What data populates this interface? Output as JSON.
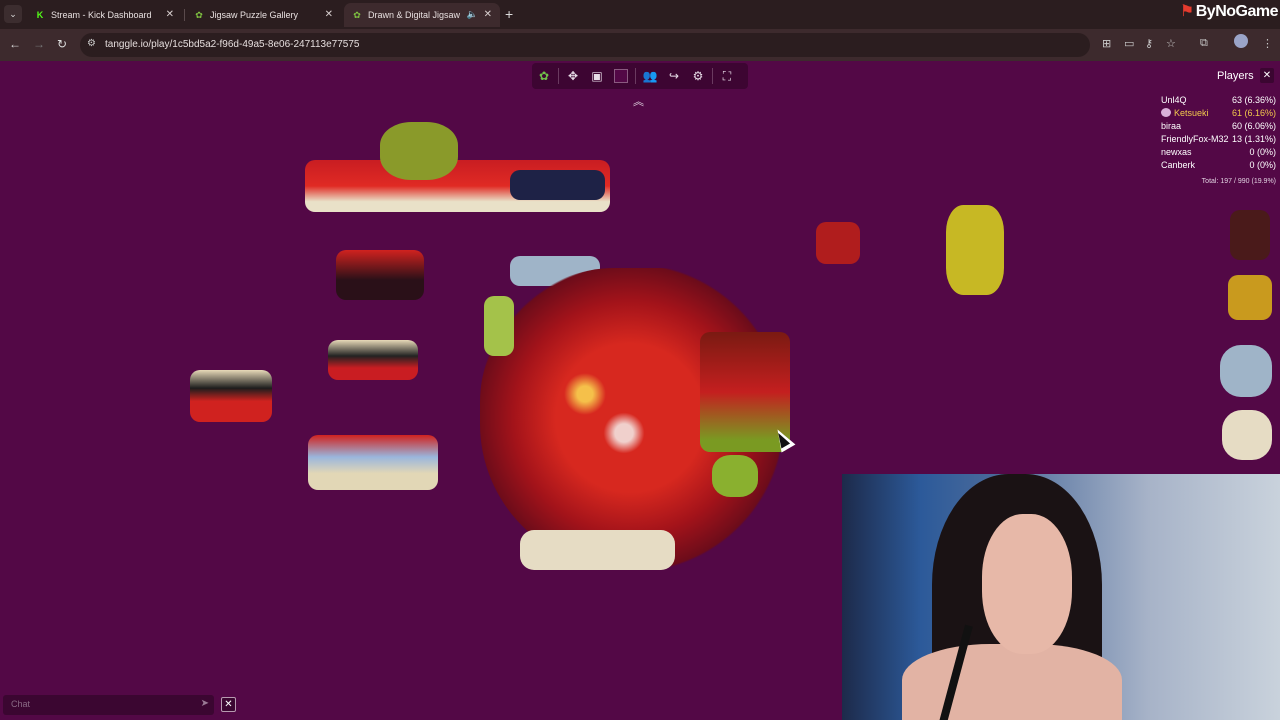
{
  "browser": {
    "tabs": [
      {
        "label": "Stream - Kick Dashboard",
        "icon": "kick-icon"
      },
      {
        "label": "Jigsaw Puzzle Gallery",
        "icon": "tanggle-icon"
      },
      {
        "label": "Drawn & Digital Jigsaw",
        "icon": "tanggle-icon",
        "active": true
      }
    ],
    "url": "tanggle.io/play/1c5bd5a2-f96d-49a5-8e06-247113e77575",
    "brand": "ByNoGame"
  },
  "players": {
    "title": "Players",
    "list": [
      {
        "name": "Unl4Q",
        "score": "63 (6.36%)"
      },
      {
        "name": "Ketsueki",
        "score": "61 (6.16%)",
        "self": true
      },
      {
        "name": "biraa",
        "score": "60 (6.06%)"
      },
      {
        "name": "FriendlyFox-M32",
        "score": "13 (1.31%)"
      },
      {
        "name": "newxas",
        "score": "0 (0%)"
      },
      {
        "name": "Canberk",
        "score": "0 (0%)"
      }
    ],
    "total": "Total: 197 / 990 (19.9%)"
  },
  "chat": {
    "placeholder": "Chat"
  },
  "colors": {
    "board": "#530846",
    "panel": "#3b0631",
    "highlight": "#f2c94c"
  }
}
